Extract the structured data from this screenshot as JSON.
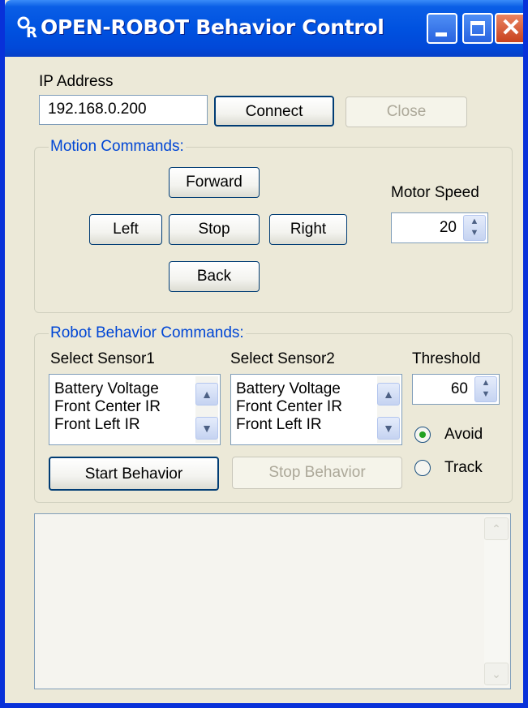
{
  "window": {
    "title": "OPEN-ROBOT Behavior Control",
    "icon": "OR-app-icon",
    "accent": "#0052e0",
    "close_color": "#c8421e"
  },
  "connection": {
    "ip_label": "IP Address",
    "ip_value": "192.168.0.200",
    "connect_label": "Connect",
    "close_label": "Close"
  },
  "motion": {
    "group_title": "Motion Commands:",
    "forward_label": "Forward",
    "left_label": "Left",
    "stop_label": "Stop",
    "right_label": "Right",
    "back_label": "Back",
    "speed_label": "Motor Speed",
    "speed_value": "20"
  },
  "behavior": {
    "group_title": "Robot Behavior Commands:",
    "sensor1_label": "Select Sensor1",
    "sensor2_label": "Select Sensor2",
    "threshold_label": "Threshold",
    "threshold_value": "60",
    "sensor1_items": [
      "Battery Voltage",
      "Front Center IR",
      "Front Left IR"
    ],
    "sensor2_items": [
      "Battery Voltage",
      "Front Center IR",
      "Front Left IR"
    ],
    "avoid_label": "Avoid",
    "track_label": "Track",
    "selected_mode": "Avoid",
    "start_label": "Start Behavior",
    "stop_label": "Stop Behavior"
  },
  "icons": {
    "minimize": "minimize-icon",
    "maximize": "maximize-icon",
    "close": "close-icon",
    "spin": "up-down-arrows-icon",
    "scroll_up": "chevron-up-icon",
    "scroll_down": "chevron-down-icon"
  }
}
